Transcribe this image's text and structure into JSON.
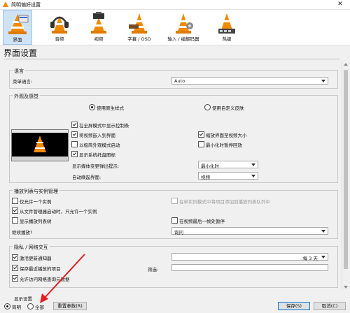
{
  "window": {
    "title": "简明偏好设置",
    "close_glyph": "✕"
  },
  "toolbar": {
    "items": [
      {
        "label": "界面",
        "icon": "interface-cone-icon",
        "selected": true
      },
      {
        "label": "音频",
        "icon": "headphones-cone-icon"
      },
      {
        "label": "视频",
        "icon": "video-cone-icon"
      },
      {
        "label": "字幕 / OSD",
        "icon": "subtitles-cone-icon"
      },
      {
        "label": "输入 / 编解码器",
        "icon": "codec-cone-icon"
      },
      {
        "label": "热键",
        "icon": "hotkeys-cone-icon"
      }
    ]
  },
  "page_title": "界面设置",
  "language": {
    "group_title": "语言",
    "menu_language_label": "菜单语言:",
    "menu_language_value": "Auto"
  },
  "appearance": {
    "group_title": "外观及感觉",
    "native_style_label": "使用原生样式",
    "custom_skin_label": "使用自定义皮肤",
    "fullscreen_controller": "在全屏模式中显示控制条",
    "integrate_video": "将视频嵌入到界面",
    "resize_to_video": "缩放界面至视频大小",
    "minimal_view": "以极简外观模式启动",
    "pause_minimized": "最小化时暂停回放",
    "systray": "显示系统托盘图标",
    "media_popup_label": "显示媒体变更弹出提示:",
    "media_popup_value": "最小化时",
    "auto_raise_label": "自动唤起界面:",
    "auto_raise_value": "视频"
  },
  "playlist": {
    "group_title": "播放列表与实例管理",
    "one_instance": "仅允许一个实例",
    "enqueue_single": "在单实例模式中将项目添加到播放列表队列中",
    "one_instance_file_manager": "从文件管理器启动时，只允许一个实例",
    "show_playlist_tree": "显示播放列表树",
    "pause_last_frame": "在视频最后一帧处暂停",
    "continue_label": "继续播放?",
    "continue_value": "询问"
  },
  "privacy": {
    "group_title": "隐私 / 网络交互",
    "check_updates": "激活更新通知器",
    "update_interval": "每 3 天",
    "save_recent": "保存最近播放的项目",
    "filter_label": "筛选:",
    "allow_metadata": "允许访问网络查询元数据"
  },
  "show_settings": {
    "group_title": "显示设置",
    "simple_label": "简明",
    "all_label": "全部"
  },
  "buttons": {
    "reset": "重置参数(R)",
    "save": "保存(S)",
    "cancel": "取消(C)"
  },
  "colors": {
    "selected_tab": "#cfe3f7",
    "cone_orange": "#f08a00",
    "annotation_arrow": "#e02020"
  }
}
